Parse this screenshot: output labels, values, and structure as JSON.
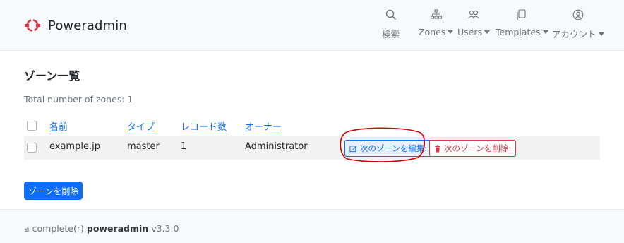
{
  "colors": {
    "brand": "#dc3545",
    "primary": "#0d6efd",
    "danger": "#dc3545",
    "annotation": "#d20000"
  },
  "navbar": {
    "brand": {
      "name": "Poweradmin",
      "logo_icon": "poweradmin-logo-icon"
    },
    "items": [
      {
        "label": "検索",
        "icon": "search-icon",
        "dropdown": false
      },
      {
        "label": "Zones",
        "icon": "sitemap-icon",
        "dropdown": true
      },
      {
        "label": "Users",
        "icon": "people-icon",
        "dropdown": true
      },
      {
        "label": "Templates",
        "icon": "copy-icon",
        "dropdown": true
      },
      {
        "label": "アカウント",
        "icon": "person-circle-icon",
        "dropdown": true
      }
    ]
  },
  "page": {
    "title": "ゾーン一覧",
    "total_label": "Total number of zones: 1"
  },
  "table": {
    "headers": [
      "名前",
      "タイプ",
      "レコード数",
      "オーナー"
    ],
    "rows": [
      {
        "name": "example.jp",
        "type": "master",
        "records": "1",
        "owner": "Administrator",
        "edit_label": "次のゾーンを編集:",
        "delete_label": "次のゾーンを削除:"
      }
    ]
  },
  "actions": {
    "delete_zones_label": "ゾーンを削除"
  },
  "footer": {
    "prefix": "a complete(r) ",
    "brand": "poweradmin",
    "version": " v3.3.0"
  }
}
